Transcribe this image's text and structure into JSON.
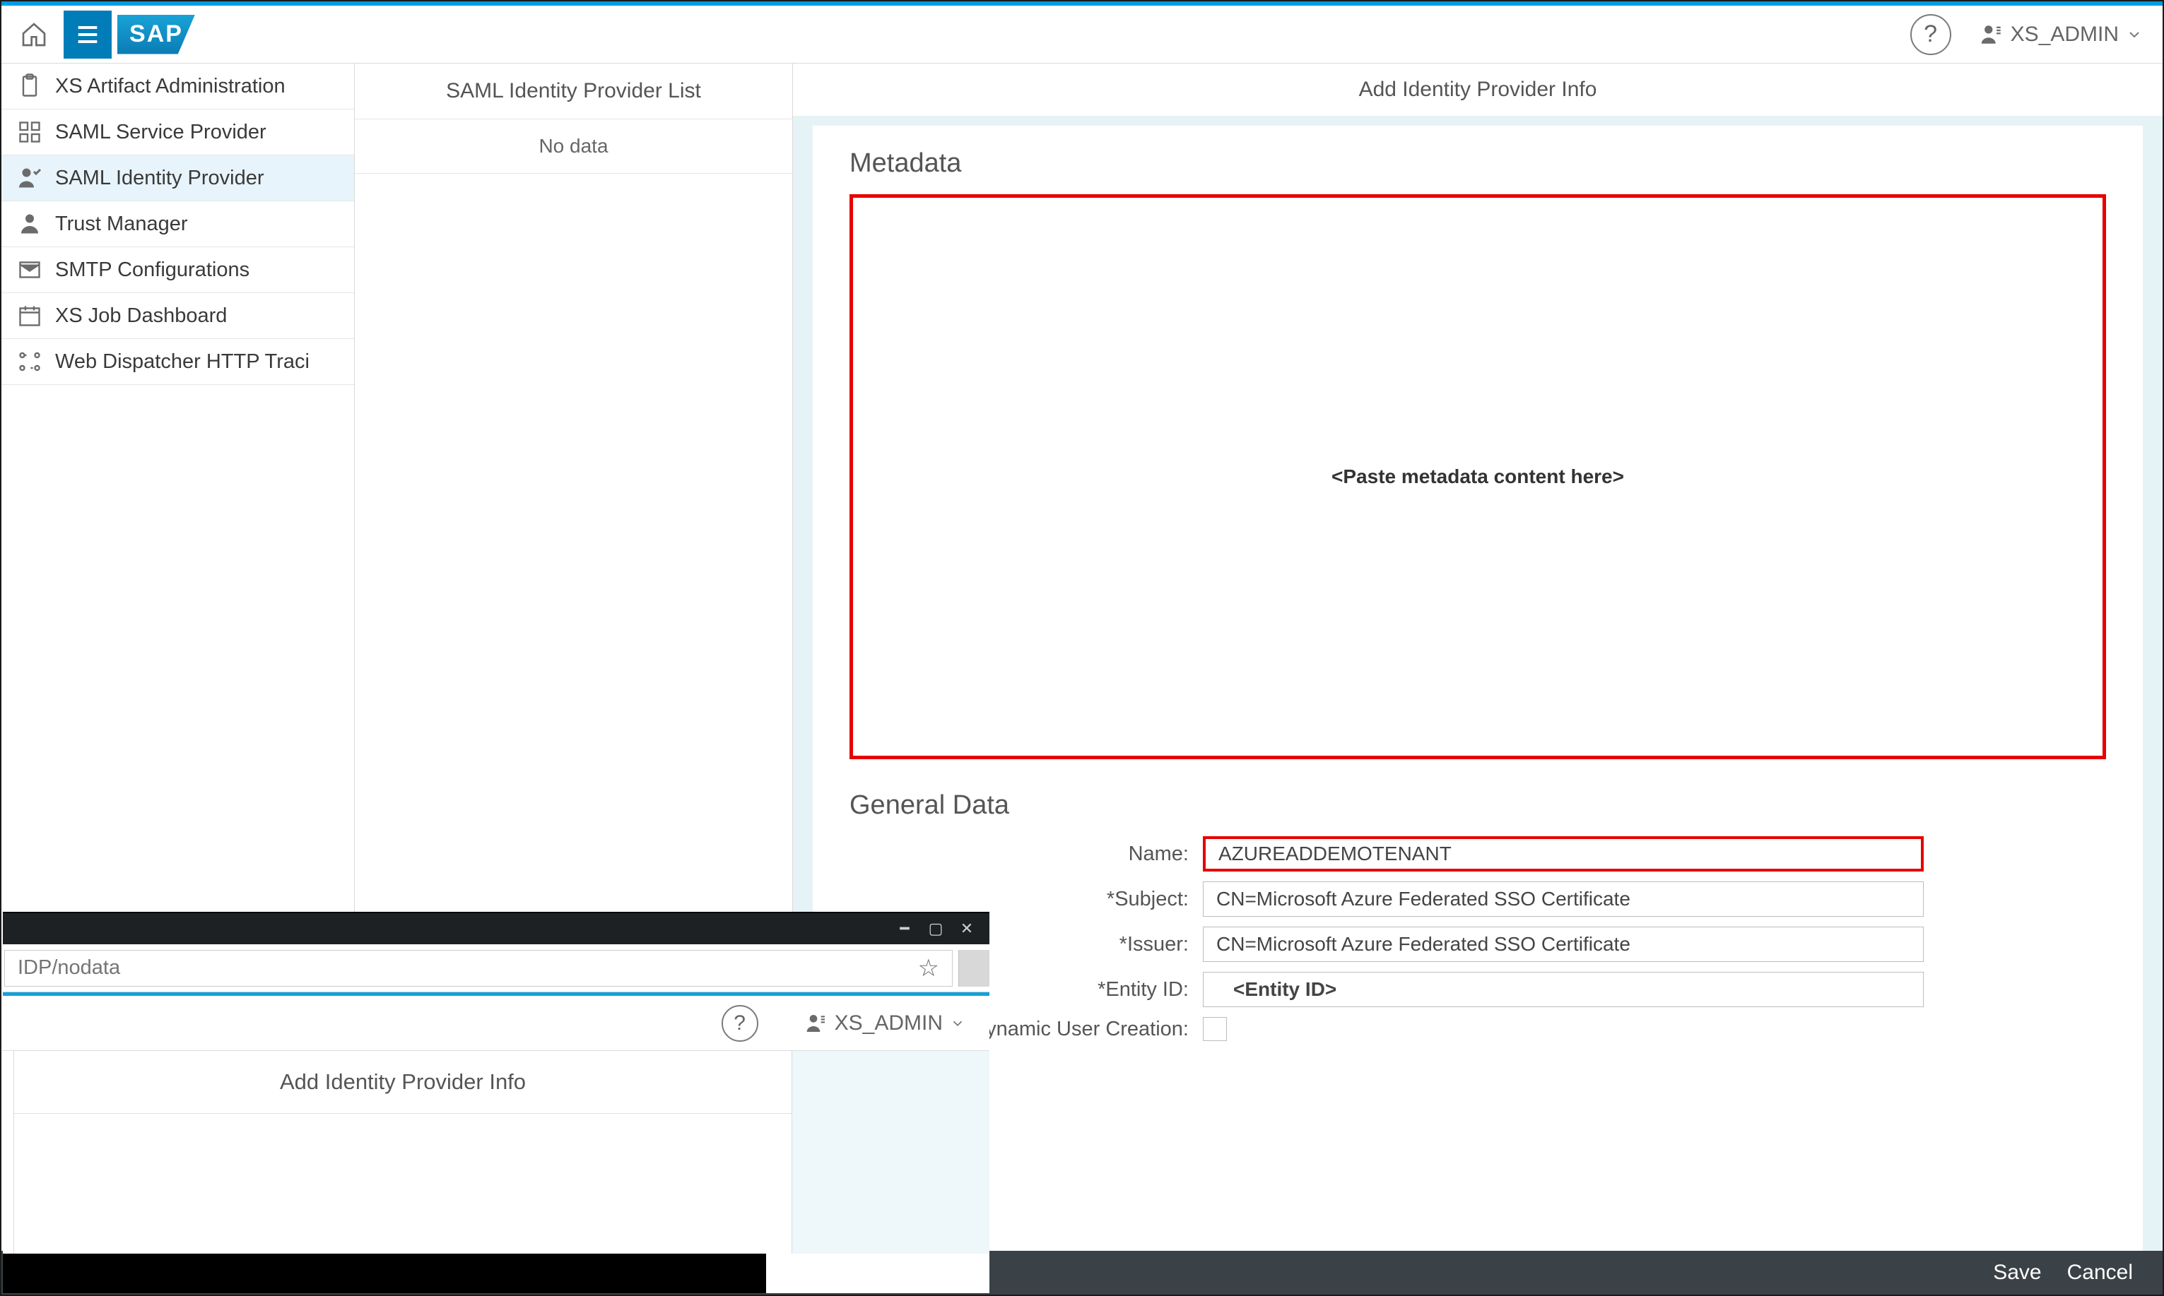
{
  "logo_text": "SAP",
  "header_user": "XS_ADMIN",
  "sidebar": {
    "items": [
      {
        "label": "XS Artifact Administration"
      },
      {
        "label": "SAML Service Provider"
      },
      {
        "label": "SAML Identity Provider"
      },
      {
        "label": "Trust Manager"
      },
      {
        "label": "SMTP Configurations"
      },
      {
        "label": "XS Job Dashboard"
      },
      {
        "label": "Web Dispatcher HTTP Traci"
      }
    ]
  },
  "list": {
    "title": "SAML Identity Provider List",
    "empty": "No data"
  },
  "main": {
    "title": "Add Identity Provider Info",
    "metadata_section": "Metadata",
    "metadata_placeholder": "<Paste metadata content here>",
    "general_section": "General Data",
    "form": {
      "name_label": "Name:",
      "name_value": "AZUREADDEMOTENANT",
      "subject_label": "*Subject:",
      "subject_value": "CN=Microsoft Azure Federated SSO Certificate",
      "issuer_label": "*Issuer:",
      "issuer_value": "CN=Microsoft Azure Federated SSO Certificate",
      "entity_label": "*Entity ID:",
      "entity_value": "<Entity ID>",
      "dyn_label": "Dynamic User Creation:"
    }
  },
  "actions": {
    "save": "Save",
    "cancel": "Cancel"
  },
  "inset": {
    "url": "IDP/nodata",
    "user": "XS_ADMIN",
    "title": "Add Identity Provider Info"
  }
}
